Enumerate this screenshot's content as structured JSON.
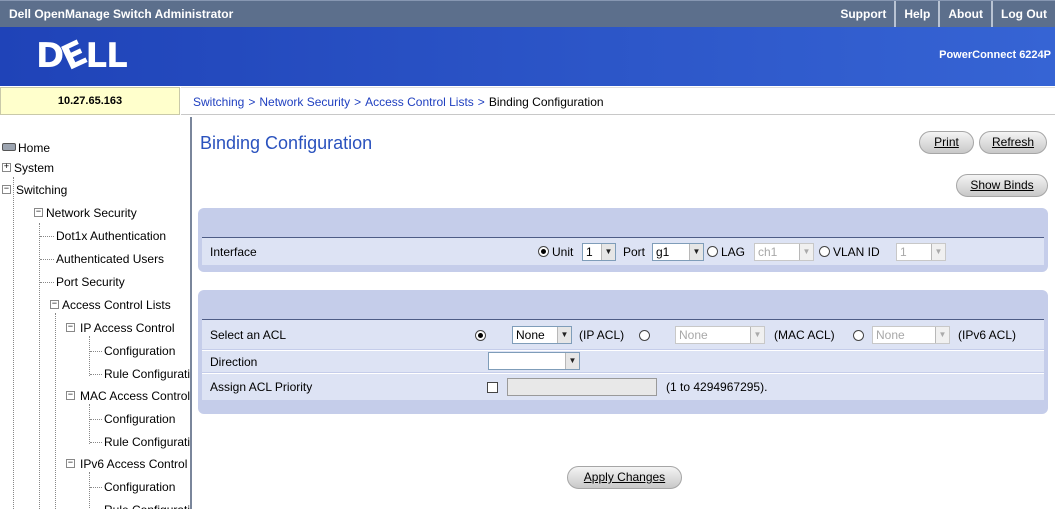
{
  "header": {
    "app_title": "Dell OpenManage Switch Administrator",
    "nav": [
      "Support",
      "Help",
      "About",
      "Log Out"
    ],
    "logo_text": "DELL",
    "model": "PowerConnect 6224P"
  },
  "ip_address": "10.27.65.163",
  "breadcrumb": [
    "Switching",
    "Network Security",
    "Access Control Lists",
    "Binding Configuration"
  ],
  "sidebar": {
    "items": [
      {
        "label": "Home"
      },
      {
        "label": "System"
      },
      {
        "label": "Switching"
      },
      {
        "label": "Network Security"
      },
      {
        "label": "Dot1x Authentication"
      },
      {
        "label": "Authenticated Users"
      },
      {
        "label": "Port Security"
      },
      {
        "label": "Access Control Lists"
      },
      {
        "label": "IP Access Control"
      },
      {
        "label": "Configuration"
      },
      {
        "label": "Rule Configuration"
      },
      {
        "label": "MAC Access Control"
      },
      {
        "label": "Configuration"
      },
      {
        "label": "Rule Configuration"
      },
      {
        "label": "IPv6 Access Control"
      },
      {
        "label": "Configuration"
      },
      {
        "label": "Rule Configuration"
      }
    ]
  },
  "main": {
    "title": "Binding Configuration",
    "print_label": "Print",
    "refresh_label": "Refresh",
    "show_binds_label": "Show Binds",
    "interface": {
      "label": "Interface",
      "unit_label": "Unit",
      "unit_value": "1",
      "port_label": "Port",
      "port_value": "g1",
      "lag_label": "LAG",
      "lag_value": "ch1",
      "vlan_label": "VLAN ID",
      "vlan_value": "1"
    },
    "acl": {
      "select_label": "Select an ACL",
      "ip_acl_value": "None",
      "ip_acl_label": "(IP ACL)",
      "mac_acl_value": "None",
      "mac_acl_label": "(MAC ACL)",
      "ipv6_acl_value": "None",
      "ipv6_acl_label": "(IPv6 ACL)",
      "direction_label": "Direction",
      "direction_value": "",
      "priority_label": "Assign ACL Priority",
      "priority_range": "(1 to 4294967295)."
    },
    "apply_label": "Apply Changes"
  }
}
